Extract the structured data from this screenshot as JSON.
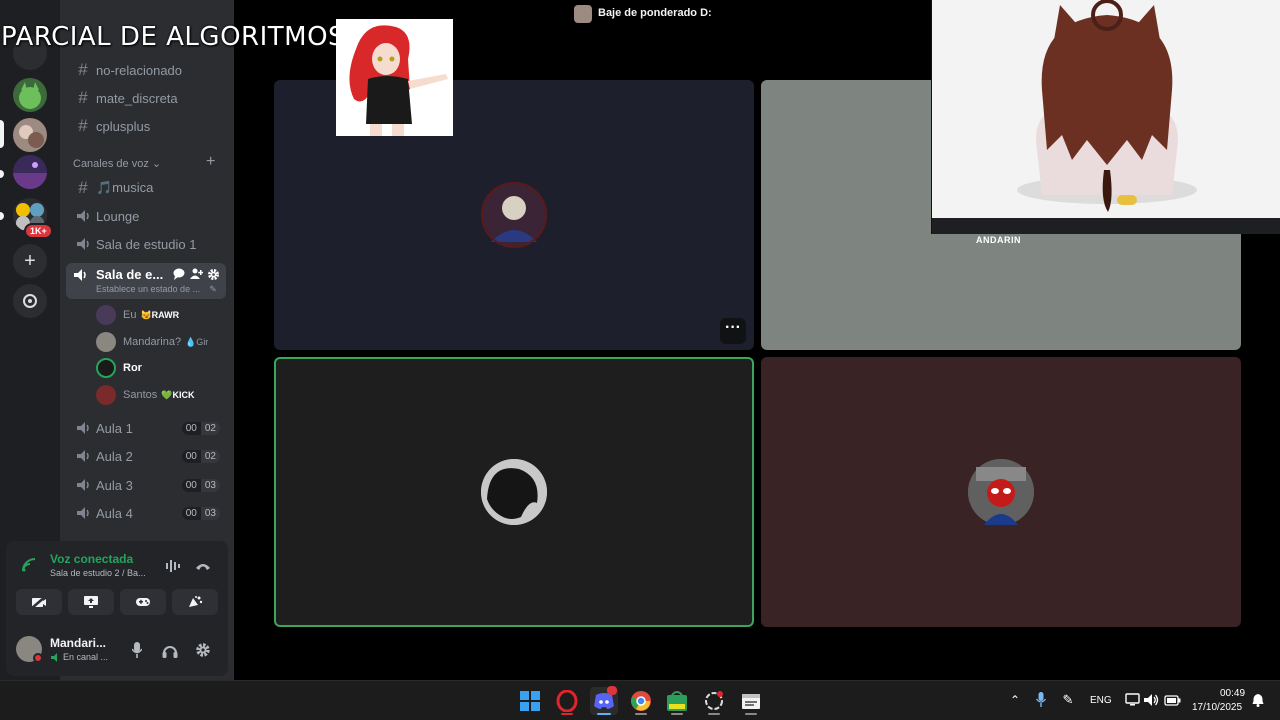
{
  "overlay_title": "PARCIAL DE ALGORITMOS",
  "window_title": "Baje de ponderado D:",
  "channel_list": {
    "text_channels": [
      "no-relacionado",
      "mate_discreta",
      "cplusplus"
    ],
    "voice_category": "Canales de voz",
    "musica": "🎵musica",
    "lounge": "Lounge",
    "sala1": "Sala de estudio 1",
    "active_channel": {
      "name": "Sala de e...",
      "status": "Establece un estado de ..."
    },
    "members": [
      {
        "name": "Eu",
        "tag": "😼RAWR",
        "tag_color": "#ffffff"
      },
      {
        "name": "Mandarina?",
        "tag": "💧Gir",
        "tag_color": "#949ba4"
      },
      {
        "name": "Ror",
        "tag": "",
        "tag_color": "#ffffff"
      },
      {
        "name": "Santos",
        "tag": "💚KICK",
        "tag_color": "#ffffff"
      }
    ],
    "aulas": [
      {
        "name": "Aula 1",
        "a": "00",
        "b": "02"
      },
      {
        "name": "Aula 2",
        "a": "00",
        "b": "02"
      },
      {
        "name": "Aula 3",
        "a": "00",
        "b": "03"
      },
      {
        "name": "Aula 4",
        "a": "00",
        "b": "03"
      }
    ]
  },
  "server_badge": "1K+",
  "voice_panel": {
    "title": "Voz conectada",
    "subtitle": "Sala de estudio 2 / Ba...",
    "user_name": "Mandari...",
    "user_status": "En canal ..."
  },
  "tiles": {
    "tile2_name": "ANDARIN"
  },
  "taskbar": {
    "lang": "ENG",
    "time": "00:49",
    "date": "17/10/2025"
  },
  "colors": {
    "accent_green": "#23a55a",
    "tile1_bg": "#1e1f2c",
    "tile2_bg": "#7e8580",
    "tile3_bg": "#1e1e1e",
    "tile4_bg": "#3a2325"
  }
}
